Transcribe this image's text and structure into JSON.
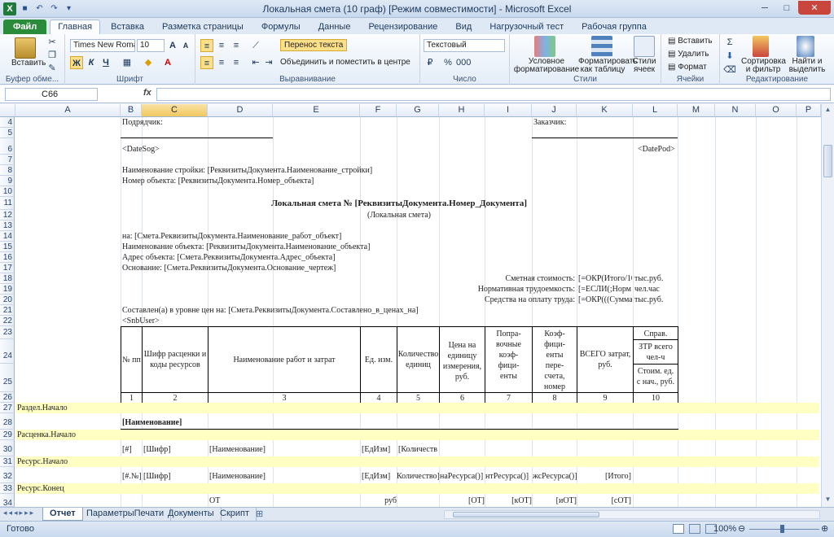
{
  "window": {
    "title": "Локальная смета (10 граф)  [Режим совместимости]  -  Microsoft Excel"
  },
  "tabs": [
    "Файл",
    "Главная",
    "Вставка",
    "Разметка страницы",
    "Формулы",
    "Данные",
    "Рецензирование",
    "Вид",
    "Нагрузочный тест",
    "Рабочая группа"
  ],
  "ribbon": {
    "clipboard": {
      "paste": "Вставить",
      "label": "Буфер обме..."
    },
    "font": {
      "name": "Times New Roman",
      "size": "10",
      "label": "Шрифт",
      "bold": "Ж",
      "italic": "К",
      "underline": "Ч"
    },
    "alignment": {
      "wrap": "Перенос текста",
      "merge": "Объединить и поместить в центре",
      "label": "Выравнивание"
    },
    "number": {
      "format": "Текстовый",
      "label": "Число"
    },
    "styles": {
      "cond": "Условное форматирование",
      "table": "Форматировать как таблицу",
      "cell": "Стили ячеек",
      "label": "Стили"
    },
    "cells": {
      "insert": "Вставить",
      "delete": "Удалить",
      "format": "Формат",
      "label": "Ячейки"
    },
    "editing": {
      "sort": "Сортировка и фильтр",
      "find": "Найти и выделить",
      "label": "Редактирование"
    }
  },
  "formula_bar": {
    "namebox": "C66",
    "fx": "fx",
    "value": ""
  },
  "columns": [
    "A",
    "B",
    "C",
    "D",
    "E",
    "F",
    "G",
    "H",
    "I",
    "J",
    "K",
    "L",
    "M",
    "N",
    "O",
    "P"
  ],
  "rows": [
    "4",
    "5",
    "6",
    "7",
    "8",
    "9",
    "10",
    "11",
    "12",
    "13",
    "14",
    "15",
    "16",
    "17",
    "18",
    "19",
    "20",
    "21",
    "22",
    "23",
    "24",
    "25",
    "26",
    "27",
    "28",
    "29",
    "30",
    "31",
    "32",
    "33",
    "34"
  ],
  "cells": {
    "podryadchik": "Подрядчик:",
    "zakazchik": "Заказчик:",
    "datesog": "<DateSog>",
    "datepod": "<DatePod>",
    "stroika": "Наименование стройки: [РеквизитыДокумента.Наименование_стройки]",
    "nomer": "Номер объекта: [РеквизитыДокумента.Номер_объекта]",
    "title": "Локальная смета № [РеквизитыДокумента.Номер_Документа]",
    "subtitle": "(Локальная смета)",
    "na": "на: [Смета.РеквизитыДокумента.Наименование_работ_объект]",
    "naimobj": "Наименование объекта: [РеквизитыДокумента.Наименование_объекта]",
    "adres": "Адрес объекта: [Смета.РеквизитыДокумента.Адрес_объекта]",
    "osnov": "Основание: [Смета.РеквизитыДокумента.Основание_чертеж]",
    "smst": "Сметная стоимость:",
    "smst_f": "[=ОКР(Итого/10",
    "smst_u": "тыс.руб.",
    "trud": "Нормативная трудоемкость:",
    "trud_f": "[=ЕСЛИ(;Норм",
    "trud_u": "чел.час",
    "sredst": "Средства на оплату труда:",
    "sredst_f": "[=ОКР(((Сумма",
    "sredst_u": "тыс.руб.",
    "sostavlen": "Составлен(а) в уровне цен на: [Смета.РеквизитыДокумента.Составлено_в_ценах_на]",
    "snbuser": "<SnbUser>",
    "h_np": "№ пп",
    "h_shifr": "Шифр расценки и коды ресурсов",
    "h_naim": "Наименование работ и затрат",
    "h_ed": "Ед. изм.",
    "h_kol": "Количество единиц",
    "h_cena": "Цена на единицу измерения, руб.",
    "h_popr": "Попра-вочные коэф-фици-енты",
    "h_koef": "Коэф-фици-енты пере-счета, номер",
    "h_vsego": "ВСЕГО затрат, руб.",
    "h_sprav": "Справ.",
    "h_ztr": "ЗТР всего чел-ч",
    "h_stoim": "Стоим. ед. с нач., руб.",
    "nums": [
      "1",
      "2",
      "3",
      "4",
      "5",
      "6",
      "7",
      "8",
      "9",
      "10"
    ],
    "razdel": "Раздел.Начало",
    "naim_b": "[Наименование]",
    "rascenka": "Расценка.Начало",
    "r30": [
      "[#]",
      "[Шифр]",
      "[Наименование]",
      "[ЕдИзм]",
      "[Количеств"
    ],
    "resurs": "Ресурс.Начало",
    "r32": [
      "[#.№]",
      "[Шифр]",
      "[Наименование]",
      "[ЕдИзм]",
      "Количество]",
      "наРесурса()]",
      "нтРесурса()]",
      "жсРесурса()]",
      "[Итого]"
    ],
    "resursk": "Ресурс.Конец",
    "r34": [
      "ОТ",
      "руб",
      "[ОТ]",
      "[кОТ]",
      "[иОТ]",
      "[сОТ]"
    ]
  },
  "sheets": [
    "Отчет",
    "ПараметрыПечати",
    "Документы",
    "Скрипт"
  ],
  "status": {
    "ready": "Готово",
    "zoom": "100%"
  }
}
